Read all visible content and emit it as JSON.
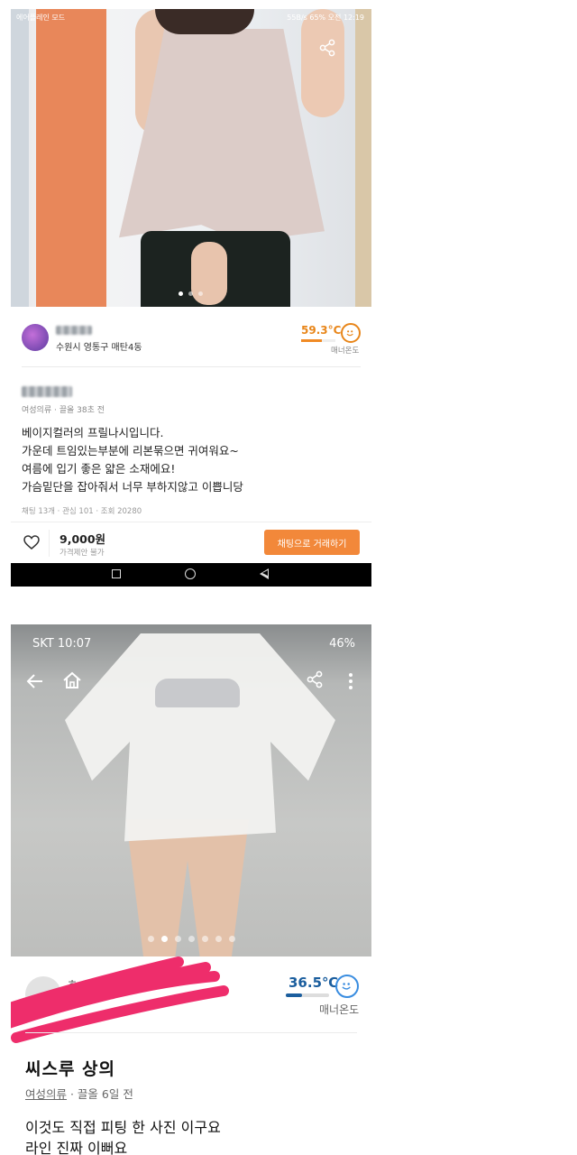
{
  "shot1": {
    "status": {
      "left": "에어플레인 모드",
      "right": "55B/s  65%  오전 12:19"
    },
    "photo_dots": {
      "count": 3,
      "active": 0
    },
    "seller": {
      "location": "수원시 영통구 매탄4동"
    },
    "manner": {
      "temperature": "59.3°C",
      "temperature_value": 59.3,
      "label": "매너온도"
    },
    "post": {
      "category_time": "여성의류 · 끌올 38초 전",
      "description": [
        "베이지컬러의 프릴나시입니다.",
        "가운데 트임있는부분에 리본묶으면 귀여워요~",
        "여름에 입기 좋은 얇은 소재에요!",
        "가슴밑단을 잡아줘서 너무 부하지않고 이쁩니당"
      ],
      "stats": "채팅 13개 · 관심 101 · 조회 20280"
    },
    "bottom_bar": {
      "price": "9,000원",
      "negotiation": "가격제안 불가",
      "chat_button": "채팅으로 거래하기"
    },
    "colors": {
      "accent": "#f2883a",
      "temperature": "#e8861a"
    },
    "icons": [
      "share-icon",
      "avatar",
      "smile-face-icon",
      "heart-icon",
      "recent-apps-icon",
      "home-nav-icon",
      "back-nav-icon"
    ]
  },
  "shot2": {
    "status": {
      "left": "SKT 10:07",
      "right": "46%"
    },
    "photo_dots": {
      "count": 7,
      "active": 1
    },
    "manner": {
      "temperature": "36.5℃",
      "temperature_value": 36.5,
      "label": "매너온도"
    },
    "seller": {
      "name_fragment": "ㅎ"
    },
    "post": {
      "title": "씨스루 상의",
      "category": "여성의류",
      "time": " · 끌올 6일 전",
      "description": [
        "이것도 직접 피팅 한 사진 이구요",
        "라인 진짜 이뻐요"
      ]
    },
    "colors": {
      "temperature": "#1b5e9e",
      "scribble": "#ee2d6b"
    },
    "icons": [
      "back-arrow-icon",
      "home-icon",
      "share-icon",
      "more-vertical-icon",
      "smile-face-icon"
    ]
  }
}
